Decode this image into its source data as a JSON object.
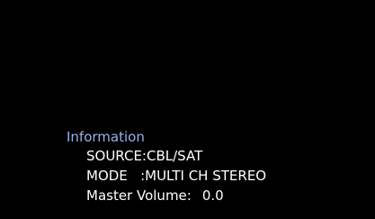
{
  "osd": {
    "title": "Information",
    "title_color": "#9ab3e6",
    "text_color": "#ffffff",
    "background_color": "#000000",
    "rows": [
      {
        "label": "SOURCE:",
        "value": "CBL/SAT"
      },
      {
        "label": "MODE   :",
        "value": "MULTI CH STEREO"
      },
      {
        "label": "Master Volume:",
        "value": "0.0"
      }
    ]
  }
}
